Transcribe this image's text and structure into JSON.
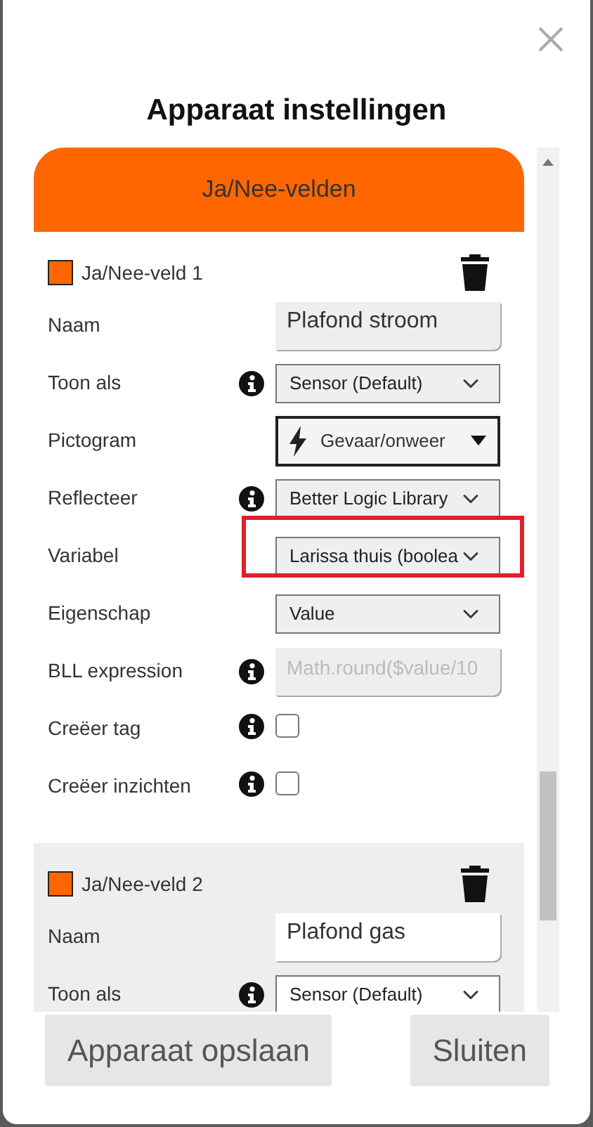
{
  "modal": {
    "title": "Apparaat instellingen"
  },
  "section": {
    "title": "Ja/Nee-velden"
  },
  "fields": [
    {
      "title": "Ja/Nee-veld 1",
      "color": "#ff6600",
      "shaded": false,
      "rows": [
        {
          "kind": "text",
          "label": "Naam",
          "info": false,
          "value": "Plafond stroom"
        },
        {
          "kind": "select",
          "label": "Toon als",
          "info": true,
          "value": "Sensor (Default)"
        },
        {
          "kind": "icon-select",
          "label": "Pictogram",
          "info": false,
          "value": "Gevaar/onweer"
        },
        {
          "kind": "select",
          "label": "Reflecteer",
          "info": true,
          "value": "Better Logic Library"
        },
        {
          "kind": "select",
          "label": "Variabel",
          "info": false,
          "value": "Larissa thuis (boolea",
          "highlighted": true
        },
        {
          "kind": "select",
          "label": "Eigenschap",
          "info": false,
          "value": "Value"
        },
        {
          "kind": "text",
          "label": "BLL expression",
          "info": true,
          "placeholder": "Math.round($value/10",
          "disabled": true
        },
        {
          "kind": "checkbox",
          "label": "Creëer tag",
          "info": true,
          "checked": false
        },
        {
          "kind": "checkbox",
          "label": "Creëer inzichten",
          "info": true,
          "checked": false
        }
      ]
    },
    {
      "title": "Ja/Nee-veld 2",
      "color": "#ff6600",
      "shaded": true,
      "rows": [
        {
          "kind": "text",
          "label": "Naam",
          "info": false,
          "value": "Plafond gas"
        },
        {
          "kind": "select",
          "label": "Toon als",
          "info": true,
          "value": "Sensor (Default)"
        }
      ]
    }
  ],
  "buttons": [
    {
      "label": "Apparaat opslaan"
    },
    {
      "label": "Sluiten"
    }
  ]
}
